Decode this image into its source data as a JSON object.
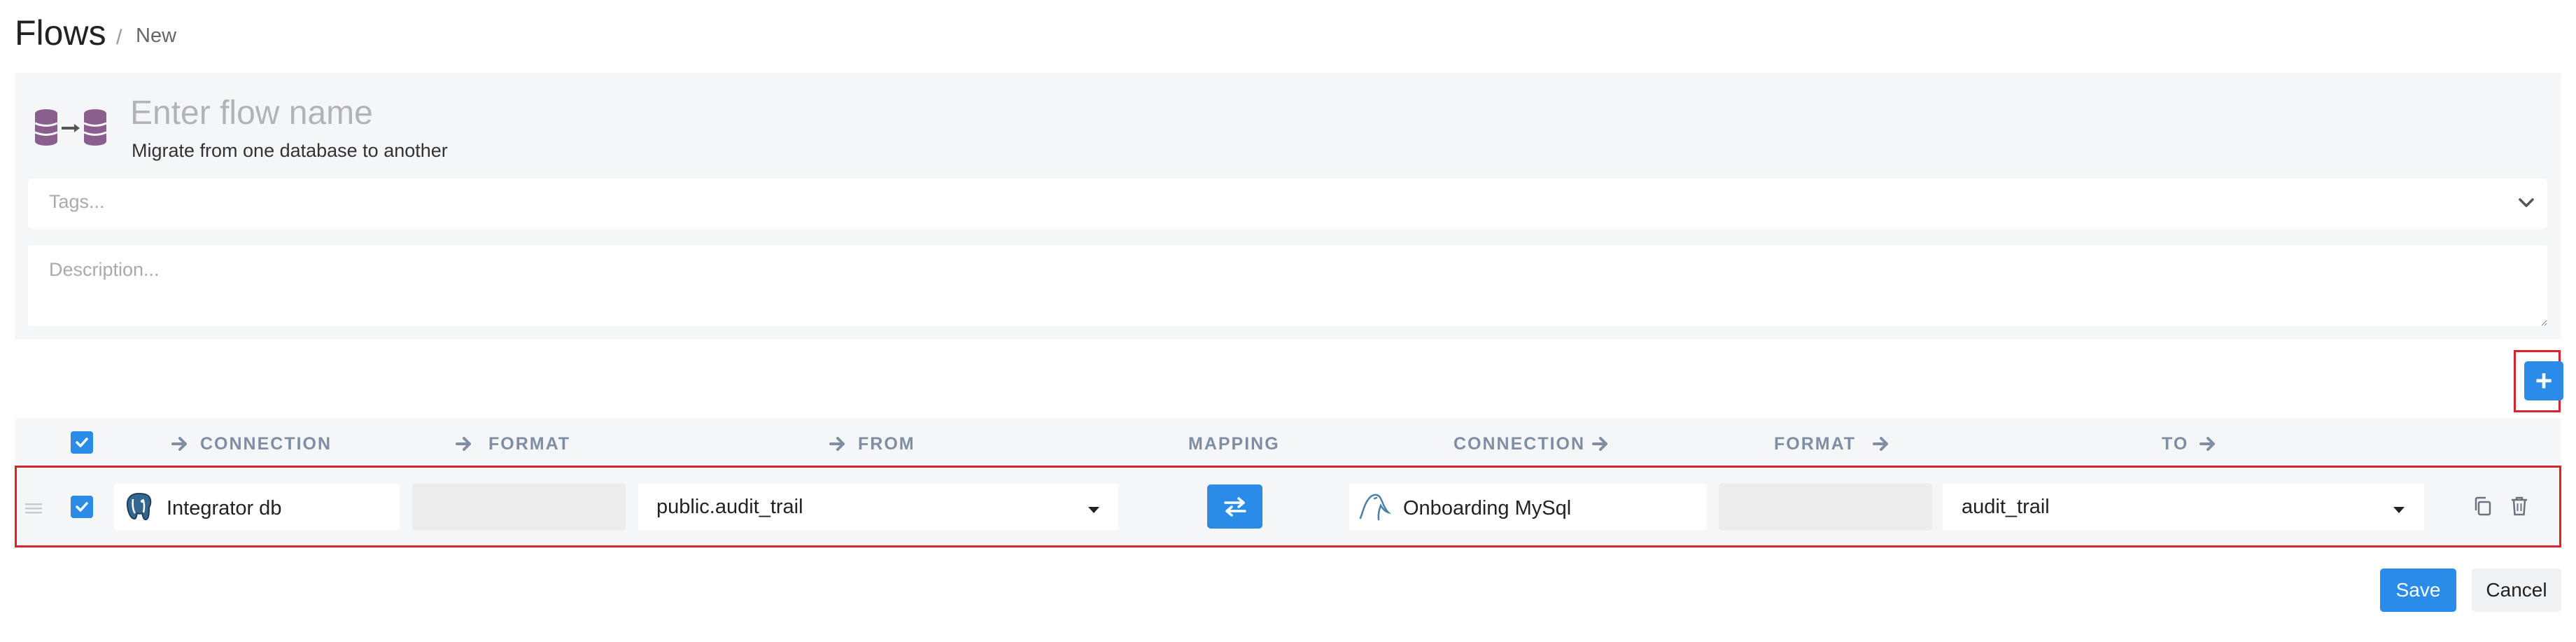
{
  "breadcrumb": {
    "title": "Flows",
    "separator": "/",
    "current": "New"
  },
  "flow": {
    "name_placeholder": "Enter flow name",
    "subtitle": "Migrate from one database to another",
    "tags_placeholder": "Tags...",
    "description_placeholder": "Description..."
  },
  "icons": {
    "flow_type": "database-to-database-icon",
    "tags_dropdown": "chevron-down-icon",
    "add": "plus-icon",
    "drag": "drag-handle-icon",
    "source_db": "postgresql-icon",
    "target_db": "mysql-icon",
    "mapping": "swap-arrows-icon",
    "duplicate": "copy-icon",
    "delete": "trash-icon"
  },
  "buttons": {
    "add_label": "+",
    "save_label": "Save",
    "cancel_label": "Cancel"
  },
  "columns": {
    "source_connection": "CONNECTION",
    "source_format": "FORMAT",
    "from": "FROM",
    "mapping": "MAPPING",
    "target_connection": "CONNECTION",
    "target_format": "FORMAT",
    "to": "TO"
  },
  "row": {
    "selected": true,
    "source_connection": "Integrator db",
    "source_format": "",
    "from": "public.audit_trail",
    "target_connection": "Onboarding MySql",
    "target_format": "",
    "to": "audit_trail"
  },
  "colors": {
    "accent": "#2a8ce8",
    "highlight": "#d9232d",
    "panel": "#f5f6f8",
    "header_text": "#7f8ea3"
  }
}
